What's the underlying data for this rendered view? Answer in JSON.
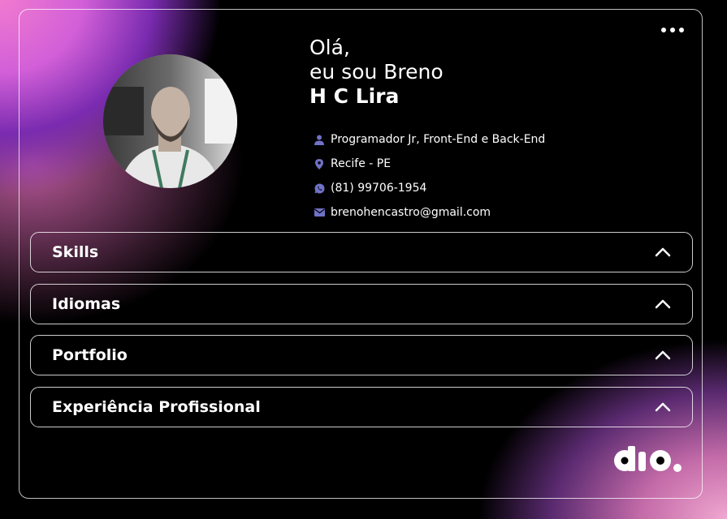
{
  "header": {
    "greeting": "Olá,",
    "intro": "eu sou Breno",
    "name": "H C Lira"
  },
  "info": [
    {
      "icon": "user-icon",
      "text": "Programador Jr, Front-End e Back-End"
    },
    {
      "icon": "location-pin-icon",
      "text": "Recife - PE"
    },
    {
      "icon": "whatsapp-icon",
      "text": "(81) 99706-1954"
    },
    {
      "icon": "mail-icon",
      "text": "brenohencastro@gmail.com"
    }
  ],
  "sections": [
    {
      "label": "Skills"
    },
    {
      "label": "Idiomas"
    },
    {
      "label": "Portfolio"
    },
    {
      "label": "Experiência Profissional"
    }
  ],
  "logo_text": "dio.",
  "colors": {
    "icon_accent": "#6f72c6",
    "background": "#000000",
    "gradient_pink": "#f07ad0",
    "gradient_purple": "#7a2bb0"
  }
}
